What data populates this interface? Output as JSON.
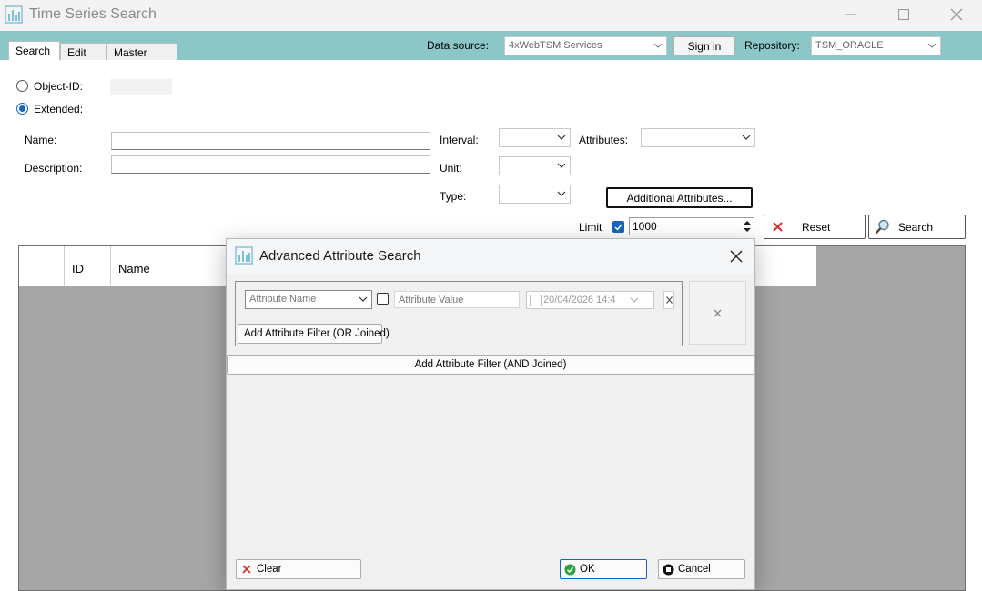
{
  "window": {
    "title": "Time Series Search",
    "minimize_icon": "minimize-icon",
    "maximize_icon": "maximize-icon",
    "close_icon": "close-icon"
  },
  "tabs": [
    {
      "label": "Search",
      "active": true
    },
    {
      "label": "Edit",
      "active": false
    },
    {
      "label": "Master data",
      "active": false
    }
  ],
  "toolbar": {
    "data_source_label": "Data source:",
    "data_source_value": "4xWebTSM Services",
    "sign_in_label": "Sign in",
    "repository_label": "Repository:",
    "repository_value": "TSM_ORACLE"
  },
  "search": {
    "object_id_label": "Object-ID:",
    "extended_label": "Extended:",
    "mode": "Extended",
    "name_label": "Name:",
    "name_value": "",
    "description_label": "Description:",
    "description_value": "",
    "interval_label": "Interval:",
    "interval_value": "",
    "unit_label": "Unit:",
    "unit_value": "",
    "type_label": "Type:",
    "type_value": "",
    "attributes_label": "Attributes:",
    "attributes_value": "",
    "additional_attributes_label": "Additional Attributes...",
    "limit_label": "Limit",
    "limit_checked": true,
    "limit_value": "1000",
    "reset_label": "Reset",
    "search_label": "Search"
  },
  "grid": {
    "columns": [
      "",
      "ID",
      "Name"
    ]
  },
  "dialog": {
    "title": "Advanced Attribute Search",
    "attribute_name_placeholder": "Attribute Name",
    "attribute_value_placeholder": "Attribute Value",
    "date_value": "20/04/2026 14:4",
    "add_or_label": "Add Attribute Filter (OR Joined)",
    "add_and_label": "Add Attribute Filter (AND Joined)",
    "clear_label": "Clear",
    "ok_label": "OK",
    "cancel_label": "Cancel"
  },
  "colors": {
    "accent": "#1565c0",
    "window_background": "#8ac7c6",
    "grid_background": "#a6a6a6",
    "dialog_background": "#f0f0f0",
    "reset_icon": "#d32f2f",
    "ok_icon": "#2e9e3e"
  }
}
